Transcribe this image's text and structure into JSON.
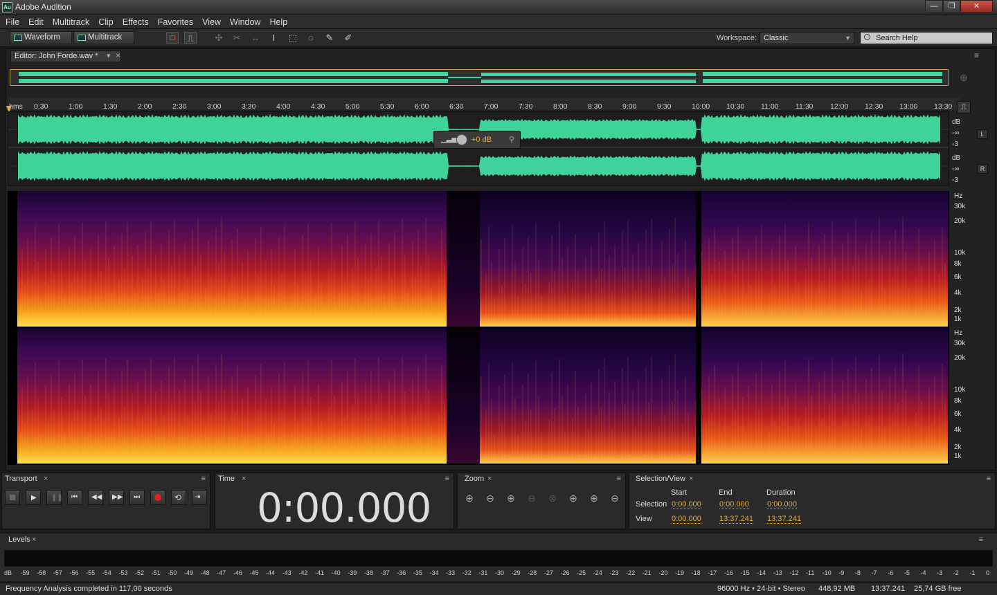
{
  "window": {
    "title": "Adobe Audition",
    "icon": "Au",
    "minimize": "—",
    "restore": "❐",
    "close": "✕"
  },
  "menu": [
    "File",
    "Edit",
    "Multitrack",
    "Clip",
    "Effects",
    "Favorites",
    "View",
    "Window",
    "Help"
  ],
  "toolbar": {
    "waveform": "Waveform",
    "multitrack": "Multitrack",
    "workspace_label": "Workspace:",
    "workspace_value": "Classic",
    "search_placeholder": "Search Help"
  },
  "editor": {
    "tab_label": "Editor: John Forde.wav *",
    "close": "×"
  },
  "ruler": {
    "unit": "hms",
    "ticks": [
      "0:30",
      "1:00",
      "1:30",
      "2:00",
      "2:30",
      "3:00",
      "3:30",
      "4:00",
      "4:30",
      "5:00",
      "5:30",
      "6:00",
      "6:30",
      "7:00",
      "7:30",
      "8:00",
      "8:30",
      "9:00",
      "9:30",
      "10:00",
      "10:30",
      "11:00",
      "11:30",
      "12:00",
      "12:30",
      "13:00",
      "13:30"
    ]
  },
  "channels": {
    "left": "L",
    "right": "R",
    "db_labels": [
      "dB",
      "-∞",
      "-3"
    ]
  },
  "hud": {
    "gain": "+0 dB"
  },
  "spectral_labels": [
    "Hz",
    "30k",
    "20k",
    "10k",
    "8k",
    "6k",
    "4k",
    "2k",
    "1k"
  ],
  "transport": {
    "title": "Transport",
    "close": "×"
  },
  "time": {
    "title": "Time",
    "close": "×",
    "value": "0:00.000"
  },
  "zoom": {
    "title": "Zoom",
    "close": "×"
  },
  "selection": {
    "title": "Selection/View",
    "close": "×",
    "headers": [
      "Start",
      "End",
      "Duration"
    ],
    "rows": [
      {
        "label": "Selection",
        "start": "0:00.000",
        "end": "0:00.000",
        "duration": "0:00.000"
      },
      {
        "label": "View",
        "start": "0:00.000",
        "end": "13:37.241",
        "duration": "13:37.241"
      }
    ]
  },
  "levels": {
    "title": "Levels",
    "close": "×",
    "scale": [
      "dB",
      "-59",
      "-58",
      "-57",
      "-56",
      "-55",
      "-54",
      "-53",
      "-52",
      "-51",
      "-50",
      "-49",
      "-48",
      "-47",
      "-46",
      "-45",
      "-44",
      "-43",
      "-42",
      "-41",
      "-40",
      "-39",
      "-38",
      "-37",
      "-36",
      "-35",
      "-34",
      "-33",
      "-32",
      "-31",
      "-30",
      "-29",
      "-28",
      "-27",
      "-26",
      "-25",
      "-24",
      "-23",
      "-22",
      "-21",
      "-20",
      "-19",
      "-18",
      "-17",
      "-16",
      "-15",
      "-14",
      "-13",
      "-12",
      "-11",
      "-10",
      "-9",
      "-8",
      "-7",
      "-6",
      "-5",
      "-4",
      "-3",
      "-2",
      "-1",
      "0"
    ]
  },
  "status": {
    "message": "Frequency Analysis completed in 117,00 seconds",
    "format": "96000 Hz • 24-bit • Stereo",
    "size": "448,92 MB",
    "duration": "13:37.241",
    "free": "25,74 GB free"
  },
  "colors": {
    "waveform": "#3fd39a",
    "accent": "#e2b040"
  }
}
